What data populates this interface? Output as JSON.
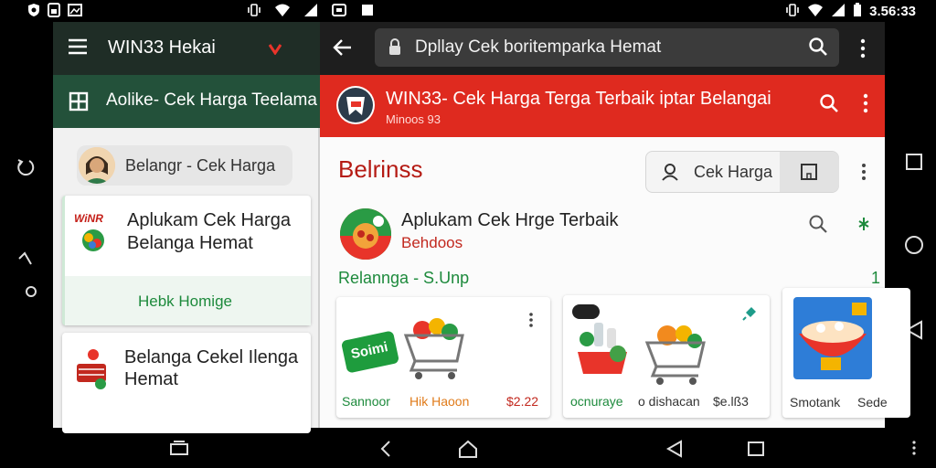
{
  "status_bar": {
    "left_icons": [
      "security-shield-icon",
      "sim-icon",
      "image-icon"
    ],
    "center_icons": [
      "vibrate-icon",
      "wifi-icon",
      "signal-icon",
      "cast-icon",
      "stop-icon"
    ],
    "right_icons": [
      "vibrate-icon",
      "wifi-icon",
      "signal-icon",
      "battery-icon"
    ],
    "time": "3.56:33"
  },
  "left_pane": {
    "header_title": "WIN33 Hekai",
    "subheader_title": "Aolike- Cek Harga Teelama",
    "search_chip": "Belangr - Cek Harga",
    "items": [
      {
        "logo_text": "WiNR",
        "title_line1": "Aplukam Cek Harga",
        "title_line2": "Belanga Hemat",
        "action": "Hebk Homige"
      },
      {
        "title_line1": "Belanga Cekel Ilenga",
        "title_line2": "Hemat"
      }
    ]
  },
  "right_pane": {
    "search_placeholder": "Dpllay Cek boritemparka Hemat",
    "banner_title": "WIN33- Cek Harga Terga Terbaik iptar Belangai",
    "banner_subtitle": "Minoos 93",
    "section_title": "Belrinss",
    "cek_harga_button": "Cek Harga",
    "featured_title": "Aplukam Cek Hrge Terbaik",
    "featured_sub": "Behdoos",
    "list_header": "Relannga - S.Unp",
    "list_count": "1",
    "products": [
      {
        "badge": "Soimi",
        "left_label": "Sannoor",
        "mid_label": "Hik Haoon",
        "price": "$2.22"
      },
      {
        "left_label": "ocnuraye",
        "mid_label": "o dishacan",
        "price": "$e.lß3"
      },
      {
        "left_label": "Smotank",
        "price": "Sede"
      }
    ]
  },
  "colors": {
    "accent_red": "#df2a1f",
    "dark_green": "#23513a",
    "green_text": "#1d8a3c",
    "dark_red_text": "#b51b14"
  }
}
